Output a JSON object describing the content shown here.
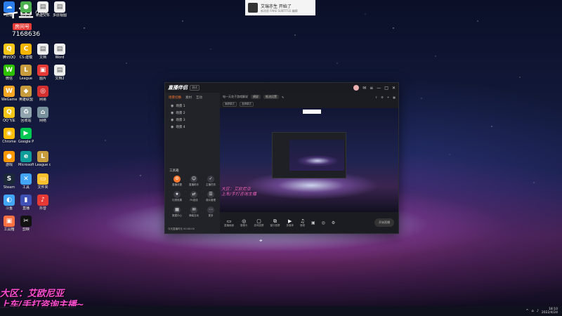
{
  "stream_overlay": {
    "logo_mark": "斗鱼",
    "logo_sub": "小鸭",
    "room_badge": "房间号",
    "room_id": "7168636",
    "caption_line1": "大区：艾欧尼亚",
    "caption_line2": "上车/手打咨询主播~"
  },
  "notification": {
    "title": "艾瑞亦生 开始了",
    "subtitle": "新消息 FAKE SUBTITLE 编辑"
  },
  "desktop_icons": [
    {
      "label": "云端",
      "color": "#2b7de9",
      "glyph": "☁"
    },
    {
      "label": "欧尼亚",
      "color": "#4caf50",
      "glyph": "●"
    },
    {
      "label": "新建文本",
      "color": "#eeeeee",
      "glyph": "▤"
    },
    {
      "label": "多层视图",
      "color": "#eeeeee",
      "glyph": "▤"
    },
    {
      "label": "腾讯QQ",
      "color": "#f5c518",
      "glyph": "Q"
    },
    {
      "label": "CS:建模",
      "color": "#f4b400",
      "glyph": "C"
    },
    {
      "label": "文档",
      "color": "#eeeeee",
      "glyph": "▤"
    },
    {
      "label": "Word",
      "color": "#eeeeee",
      "glyph": "▤"
    },
    {
      "label": "微信",
      "color": "#2dc100",
      "glyph": "W"
    },
    {
      "label": "League",
      "color": "#c89b3c",
      "glyph": "L"
    },
    {
      "label": "图片",
      "color": "#e53935",
      "glyph": "▣"
    },
    {
      "label": "文档2",
      "color": "#eeeeee",
      "glyph": "▤"
    },
    {
      "label": "WeGame",
      "color": "#f5a623",
      "glyph": "W"
    },
    {
      "label": "英雄联盟",
      "color": "#c89b3c",
      "glyph": "◆"
    },
    {
      "label": "网易",
      "color": "#d32f2f",
      "glyph": "◎"
    },
    {
      "label": "QQ飞车",
      "color": "#f5c518",
      "glyph": "Q"
    },
    {
      "label": "回收站",
      "color": "#90a4ae",
      "glyph": "♻"
    },
    {
      "label": "网络",
      "color": "#78909c",
      "glyph": "⌂"
    },
    {
      "label": "Chrome",
      "color": "#fbbc05",
      "glyph": "◉"
    },
    {
      "label": "Google Play",
      "color": "#00c853",
      "glyph": "▶"
    },
    {
      "label": "游戏",
      "color": "#ff9800",
      "glyph": "●"
    },
    {
      "label": "Microsoft Edge",
      "color": "#0f9d9a",
      "glyph": "e"
    },
    {
      "label": "League of Legends",
      "color": "#c89b3c",
      "glyph": "L"
    },
    {
      "label": "Steam",
      "color": "#1b2838",
      "glyph": "S"
    },
    {
      "label": "工具",
      "color": "#42a5f5",
      "glyph": "✕"
    },
    {
      "label": "文件夹",
      "color": "#fbc02d",
      "glyph": "▭"
    },
    {
      "label": "斗鱼",
      "color": "#42a5f5",
      "glyph": "◐"
    },
    {
      "label": "直播",
      "color": "#3f51b5",
      "glyph": "▮"
    },
    {
      "label": "抖音",
      "color": "#e53935",
      "glyph": "♪"
    },
    {
      "label": "工具箱",
      "color": "#ff7043",
      "glyph": "▣"
    },
    {
      "label": "剪映",
      "color": "#111111",
      "glyph": "✂"
    }
  ],
  "app": {
    "brand": "直播伴侣",
    "badge": "测试",
    "left_tabs": [
      "场景切换",
      "素材",
      "互动"
    ],
    "scenes": [
      "场景 1",
      "场景 2",
      "场景 3",
      "场景 4"
    ],
    "tools_title": "工具箱",
    "tools": [
      {
        "label": "直播设置",
        "glyph": "⚙"
      },
      {
        "label": "直播助手",
        "glyph": "☺"
      },
      {
        "label": "主播任务",
        "glyph": "✓"
      },
      {
        "label": "礼物效果",
        "glyph": "★"
      },
      {
        "label": "Pk连线",
        "glyph": "⇄"
      },
      {
        "label": "观众管理",
        "glyph": "☰"
      },
      {
        "label": "数据中心",
        "glyph": "▦"
      },
      {
        "label": "弹幕互动",
        "glyph": "✉"
      },
      {
        "label": "更多",
        "glyph": "⋯"
      }
    ],
    "footer": "今天直播时长 00:00:00",
    "main_title": "电一天花子游戏解说",
    "main_pill1": "横屏",
    "main_pill2": "推流设置",
    "toolbar_chips": [
      "横屏模式",
      "竖屏模式"
    ],
    "bottom_actions": [
      {
        "label": "直播画面",
        "glyph": "▭"
      },
      {
        "label": "摄像头",
        "glyph": "◎"
      },
      {
        "label": "游戏投屏",
        "glyph": "▢"
      },
      {
        "label": "窗口投屏",
        "glyph": "⧉"
      },
      {
        "label": "多媒体",
        "glyph": "▶"
      },
      {
        "label": "音频",
        "glyph": "♫"
      }
    ],
    "start_label": "开始直播",
    "preview_overlay1": "大区：艾欧尼亚",
    "preview_overlay2": "上车/手打咨询主播"
  },
  "taskbar": {
    "time": "18:10",
    "date": "2022/4/24"
  }
}
